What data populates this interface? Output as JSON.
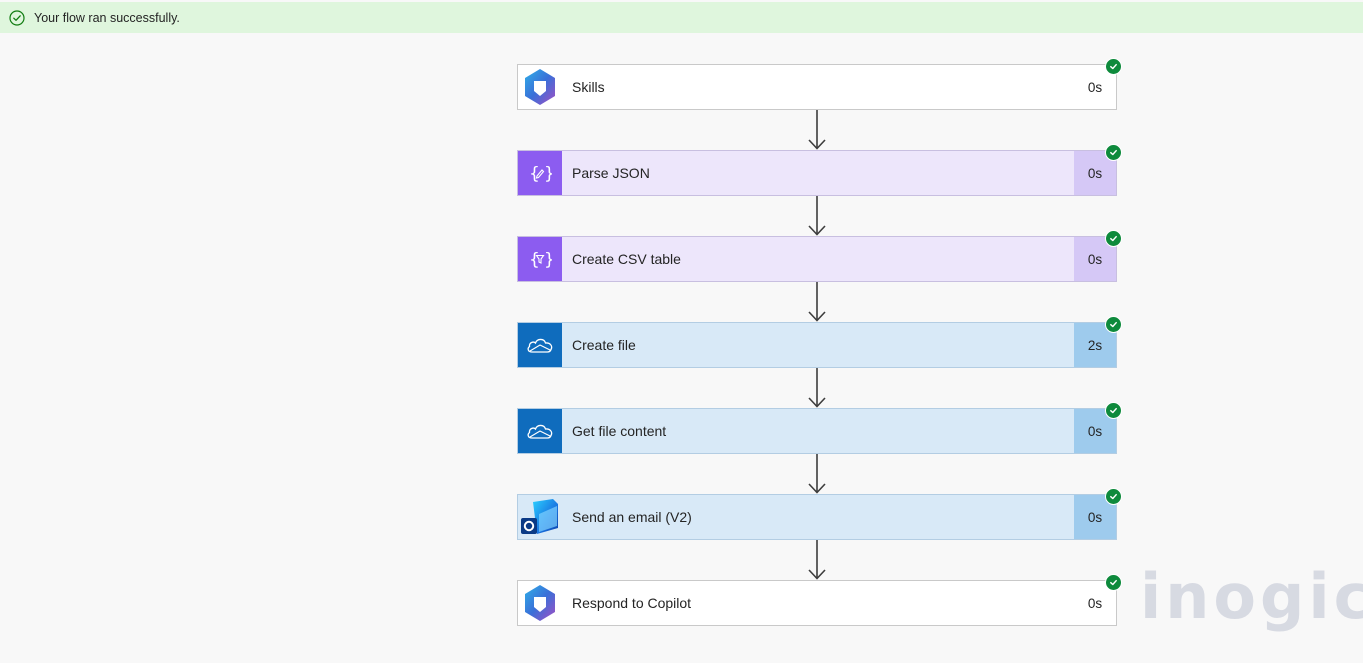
{
  "banner": {
    "message": "Your flow ran successfully.",
    "icon": "check-circle-icon",
    "color": "#dff6dd"
  },
  "steps": [
    {
      "label": "Skills",
      "duration": "0s",
      "icon": "copilot-icon",
      "theme": "white"
    },
    {
      "label": "Parse JSON",
      "duration": "0s",
      "icon": "data-operation-icon",
      "theme": "purple"
    },
    {
      "label": "Create CSV table",
      "duration": "0s",
      "icon": "data-operation-icon",
      "theme": "purple"
    },
    {
      "label": "Create file",
      "duration": "2s",
      "icon": "onedrive-icon",
      "theme": "blue"
    },
    {
      "label": "Get file content",
      "duration": "0s",
      "icon": "onedrive-icon",
      "theme": "blue"
    },
    {
      "label": "Send an email (V2)",
      "duration": "0s",
      "icon": "outlook-icon",
      "theme": "blue"
    },
    {
      "label": "Respond to Copilot",
      "duration": "0s",
      "icon": "copilot-icon",
      "theme": "white"
    }
  ],
  "status_color": "#0e8a3c",
  "watermark": "inogic"
}
